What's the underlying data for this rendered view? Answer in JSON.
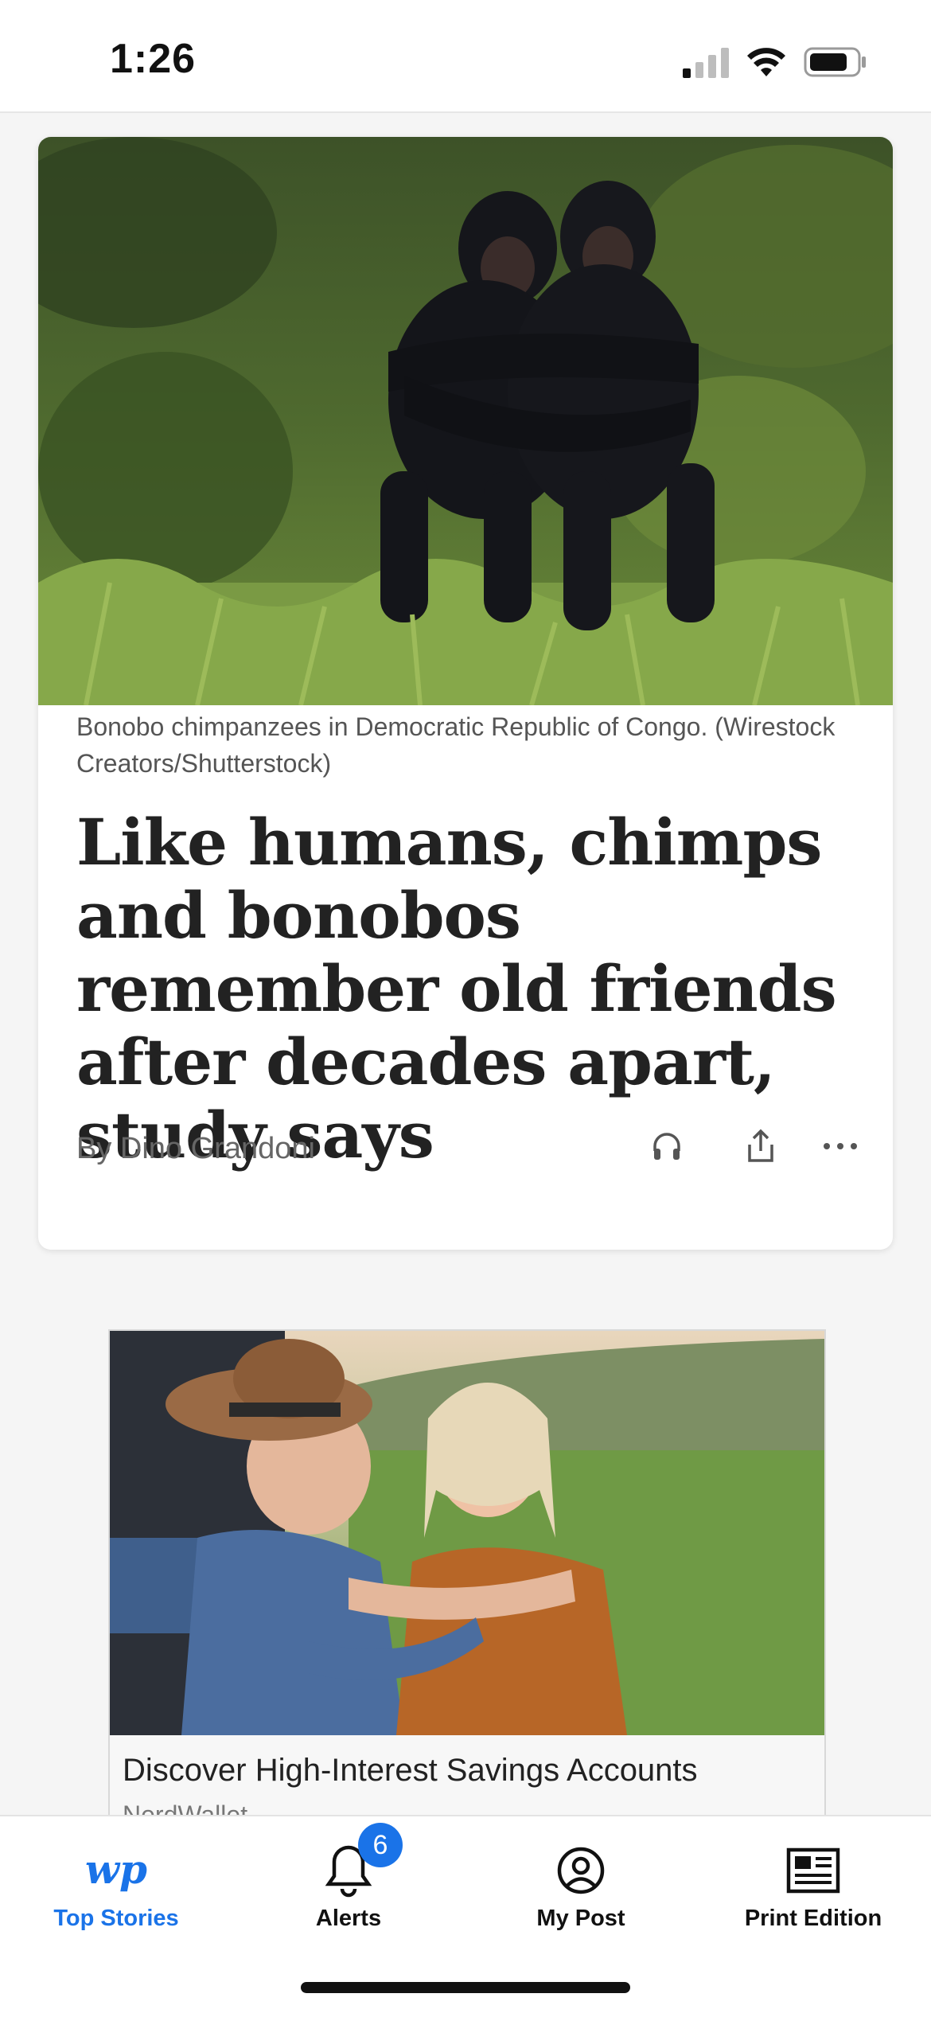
{
  "status_bar": {
    "time": "1:26",
    "icons": [
      "cellular-signal-icon",
      "wifi-icon",
      "battery-icon"
    ]
  },
  "article": {
    "image_alt": "Two bonobos embracing in tall grass",
    "caption": "Bonobo chimpanzees in Democratic Republic of Congo. (Wirestock Creators/Shutterstock)",
    "headline": "Like humans, chimps and bonobos remember old friends after decades apart, study says",
    "byline": "By Dino Grandoni",
    "actions": [
      "headphones-icon",
      "share-icon",
      "more-icon"
    ]
  },
  "ad": {
    "image_alt": "Two women hugging outdoors",
    "title": "Discover High-Interest Savings Accounts",
    "sponsor": "NerdWallet"
  },
  "tab_bar": {
    "tabs": [
      {
        "label": "Top Stories",
        "icon": "wp-logo-icon",
        "active": true
      },
      {
        "label": "Alerts",
        "icon": "bell-icon",
        "active": false
      },
      {
        "label": "My Post",
        "icon": "user-circle-icon",
        "active": false
      },
      {
        "label": "Print Edition",
        "icon": "newspaper-icon",
        "active": false
      }
    ],
    "alerts_badge": "6"
  },
  "colors": {
    "accent": "#1a73e8",
    "headline": "#222222",
    "caption": "#555555"
  }
}
